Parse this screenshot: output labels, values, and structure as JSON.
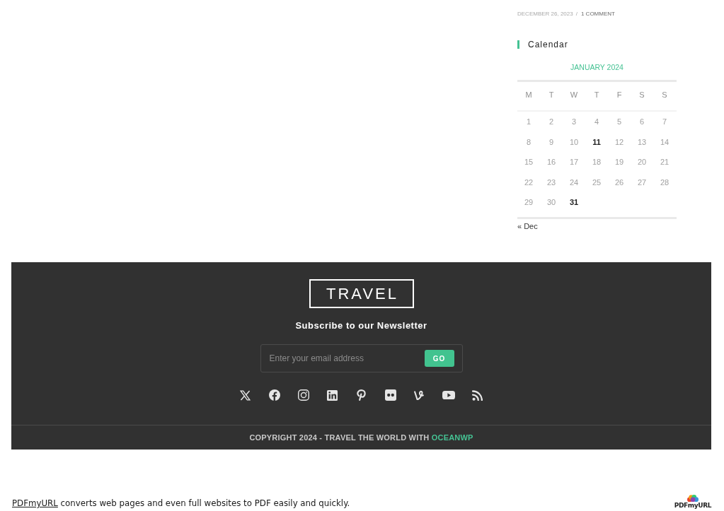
{
  "post_meta": {
    "date": "DECEMBER 26, 2023",
    "separator": "/",
    "comments": "1 COMMENT"
  },
  "calendar": {
    "title": "Calendar",
    "caption": "JANUARY 2024",
    "weekdays": [
      "M",
      "T",
      "W",
      "T",
      "F",
      "S",
      "S"
    ],
    "weeks": [
      [
        {
          "day": "1",
          "linked": false
        },
        {
          "day": "2",
          "linked": false
        },
        {
          "day": "3",
          "linked": false
        },
        {
          "day": "4",
          "linked": false
        },
        {
          "day": "5",
          "linked": false
        },
        {
          "day": "6",
          "linked": false
        },
        {
          "day": "7",
          "linked": false
        }
      ],
      [
        {
          "day": "8",
          "linked": false
        },
        {
          "day": "9",
          "linked": false
        },
        {
          "day": "10",
          "linked": false
        },
        {
          "day": "11",
          "linked": true
        },
        {
          "day": "12",
          "linked": false
        },
        {
          "day": "13",
          "linked": false
        },
        {
          "day": "14",
          "linked": false
        }
      ],
      [
        {
          "day": "15",
          "linked": false
        },
        {
          "day": "16",
          "linked": false
        },
        {
          "day": "17",
          "linked": false
        },
        {
          "day": "18",
          "linked": false
        },
        {
          "day": "19",
          "linked": false
        },
        {
          "day": "20",
          "linked": false
        },
        {
          "day": "21",
          "linked": false
        }
      ],
      [
        {
          "day": "22",
          "linked": false
        },
        {
          "day": "23",
          "linked": false
        },
        {
          "day": "24",
          "linked": false
        },
        {
          "day": "25",
          "linked": false
        },
        {
          "day": "26",
          "linked": false
        },
        {
          "day": "27",
          "linked": false
        },
        {
          "day": "28",
          "linked": false
        }
      ],
      [
        {
          "day": "29",
          "linked": false
        },
        {
          "day": "30",
          "linked": false
        },
        {
          "day": "31",
          "linked": true
        }
      ]
    ],
    "prev_link": "« Dec"
  },
  "footer": {
    "logo": "TRAVEL",
    "newsletter": {
      "heading": "Subscribe to our Newsletter",
      "placeholder": "Enter your email address",
      "button": "GO"
    },
    "social_links": [
      {
        "kind": "x"
      },
      {
        "kind": "facebook"
      },
      {
        "kind": "instagram"
      },
      {
        "kind": "linkedin"
      },
      {
        "kind": "pinterest"
      },
      {
        "kind": "flickr"
      },
      {
        "kind": "vine"
      },
      {
        "kind": "youtube"
      },
      {
        "kind": "rss"
      }
    ],
    "copyright": {
      "text": "COPYRIGHT 2024 - TRAVEL THE WORLD WITH",
      "link": "OCEANWP"
    }
  },
  "pdf_notice": {
    "link": "PDFmyURL",
    "text": "converts web pages and even full websites to PDF easily and quickly.",
    "logo": "PDFmyURL"
  }
}
